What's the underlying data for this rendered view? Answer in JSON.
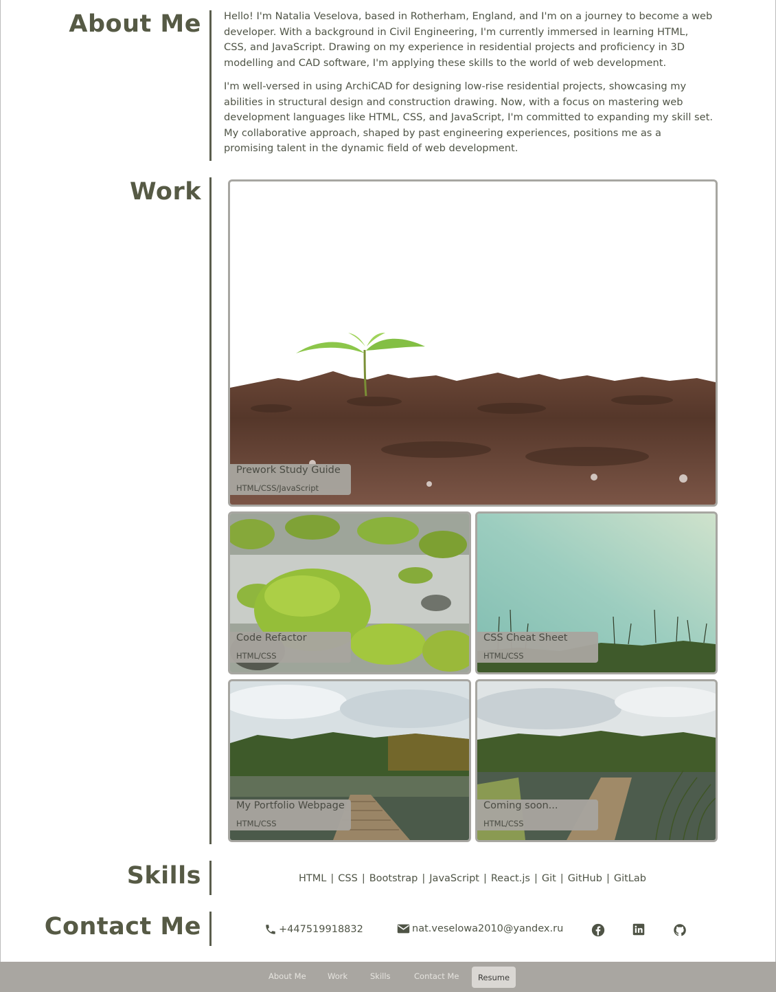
{
  "about": {
    "heading": "About Me",
    "paragraphs": [
      "Hello! I'm Natalia Veselova, based in Rotherham, England, and I'm on a journey to become a web developer. With a background in Civil Engineering, I'm currently immersed in learning HTML, CSS, and JavaScript. Drawing on my experience in residential projects and proficiency in 3D modelling and CAD software, I'm applying these skills to the world of web development.",
      "I'm well-versed in using ArchiCAD for designing low-rise residential projects, showcasing my abilities in structural design and construction drawing. Now, with a focus on mastering web development languages like HTML, CSS, and JavaScript, I'm committed to expanding my skill set. My collaborative approach, shaped by past engineering experiences, positions me as a promising talent in the dynamic field of web development."
    ]
  },
  "work": {
    "heading": "Work",
    "projects": [
      {
        "title": "Prework Study Guide",
        "tech": "HTML/CSS/JavaScript"
      },
      {
        "title": "Code Refactor",
        "tech": "HTML/CSS"
      },
      {
        "title": "CSS Cheat Sheet",
        "tech": "HTML/CSS"
      },
      {
        "title": "My Portfolio Webpage",
        "tech": "HTML/CSS"
      },
      {
        "title": "Coming soon...",
        "tech": "HTML/CSS"
      }
    ]
  },
  "skills": {
    "heading": "Skills",
    "items": [
      "HTML",
      "CSS",
      "Bootstrap",
      "JavaScript",
      "React.js",
      "Git",
      "GitHub",
      "GitLab"
    ],
    "separator": "|"
  },
  "contact": {
    "heading": "Contact Me",
    "phone": "+447519918832",
    "email": "nat.veselowa2010@yandex.ru",
    "icons": [
      "phone-icon",
      "envelope-icon",
      "facebook-icon",
      "linkedin-icon",
      "github-icon"
    ]
  },
  "nav": {
    "items": [
      "About Me",
      "Work",
      "Skills",
      "Contact Me"
    ],
    "resume": "Resume"
  },
  "colors": {
    "accent": "#565a45",
    "card_border": "#a7a6a1",
    "footer_bg": "#a9a6a1",
    "resume_bg": "#dad7d3"
  }
}
